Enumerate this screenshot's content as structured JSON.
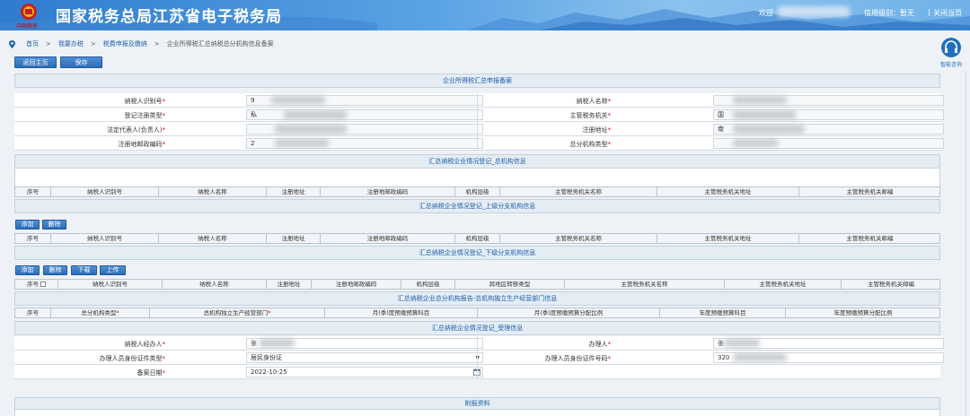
{
  "header": {
    "title": "国家税务总局江苏省电子税务局",
    "emblem_text": "中国税务",
    "welcome": "欢迎",
    "credit": "信用级别：暂无",
    "separator": "|",
    "close": "关闭当页"
  },
  "breadcrumb": [
    "首页",
    ">",
    "我要办税",
    ">",
    "税费申报及缴纳",
    ">",
    "企业所得税汇总纳税总分机构信息备案"
  ],
  "helper": {
    "label": "智能咨询"
  },
  "toolbar": {
    "back": "返回主页",
    "save": "保存"
  },
  "sections": {
    "s1": "企业所得税汇总申报备案",
    "s2": "汇总纳税企业情况登记_总机构信息",
    "s3": "汇总纳税企业情况登记_上级分支机构信息",
    "s4": "汇总纳税企业情况登记_下级分支机构信息",
    "s5": "汇总纳税企业总分机构报告-总机构独立生产经营部门信息",
    "s6": "汇总纳税企业情况登记_受理信息",
    "s7": "附报资料"
  },
  "form": {
    "taxpayer_id": "纳税人识别号",
    "taxpayer_name": "纳税人名称",
    "reg_type": "登记注册类型",
    "tax_office": "主管税务机关",
    "legal_rep": "法定代表人(负责人)",
    "reg_address": "注册地址",
    "postal_code": "注册地邮政编码",
    "branch_type": "总分机构类型",
    "taxpayer_id_val": "9",
    "taxpayer_name_val": "",
    "reg_type_val": "私",
    "tax_office_val": "国",
    "legal_rep_val": "",
    "reg_address_val": "南",
    "postal_code_val": "2",
    "branch_type_val": "",
    "required": "*"
  },
  "table_hq": [
    "序号",
    "纳税人识别号",
    "纳税人名称",
    "注册地址",
    "注册地邮政编码",
    "机构层级",
    "主管税务机关名称",
    "主管税务机关地址",
    "主管税务机关邮编"
  ],
  "table_upper": [
    "序号",
    "纳税人识别号",
    "纳税人名称",
    "注册地址",
    "注册地邮政编码",
    "机构层级",
    "主管税务机关名称",
    "主管税务机关地址",
    "主管税务机关邮编"
  ],
  "table_lower": [
    "序号",
    "纳税人识别号",
    "纳税人名称",
    "注册地址",
    "注册地邮政编码",
    "机构层级",
    "跨地区转移类型",
    "主管税务机关名称",
    "主管税务机关地址",
    "主管税务机关邮编"
  ],
  "table_dept": [
    "序号",
    "总分机构类型",
    "总机构独立生产经营部门",
    "月(季)度预缴预算科目",
    "月(季)度预缴预算分配比例",
    "年度预缴预算科目",
    "年度预缴预算分配比例"
  ],
  "upper_buttons": {
    "add": "添加",
    "delete": "删除"
  },
  "lower_buttons": {
    "add": "添加",
    "delete": "删除",
    "download": "下载",
    "upload": "上传"
  },
  "accept": {
    "agent": "纳税人经办人",
    "handler": "办理人",
    "id_type": "办理人员身份证件类型",
    "id_no": "办理人员身份证件号码",
    "date_label": "备案日期",
    "agent_val": "张",
    "handler_val": "张",
    "id_type_val": "居民身份证",
    "id_no_val": "320",
    "date_val": "2022-10-25"
  },
  "colors": {
    "accent": "#1e5fa8",
    "required": "#d40000",
    "button": "#2c6db8"
  }
}
